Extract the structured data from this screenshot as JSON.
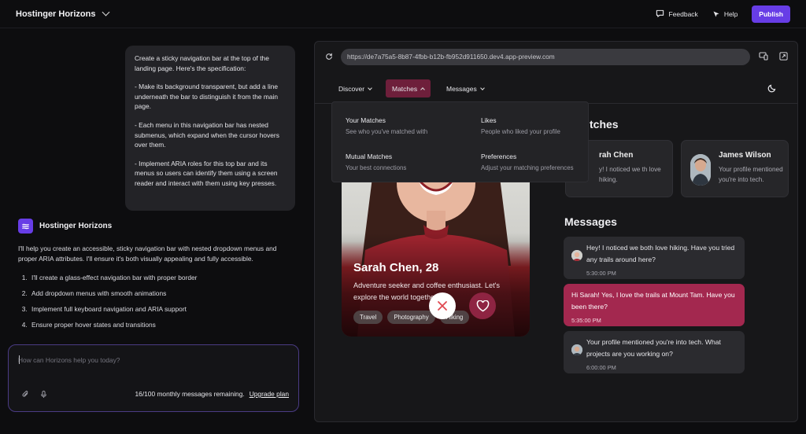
{
  "topbar": {
    "brand": "Hostinger Horizons",
    "feedback": "Feedback",
    "help": "Help",
    "publish": "Publish"
  },
  "chat": {
    "user_message": [
      "Create a sticky navigation bar at the top of the landing page. Here's the specification:",
      "- Make its background transparent, but add a line underneath the bar to distinguish it from the main page.",
      "- Each menu in this navigation bar has nested submenus, which expand when the cursor hovers over them.",
      "- Implement ARIA roles for this top bar and its menus so users can identify them using a screen reader and interact with them using key presses."
    ],
    "assistant_name": "Hostinger Horizons",
    "assistant_intro": "I'll help you create an accessible, sticky navigation bar with nested dropdown menus and proper ARIA attributes. I'll ensure it's both visually appealing and fully accessible.",
    "assistant_steps": [
      "I'll create a glass-effect navigation bar with proper border",
      "Add dropdown menus with smooth animations",
      "Implement full keyboard navigation and ARIA support",
      "Ensure proper hover states and transitions"
    ],
    "composer_placeholder": "How can Horizons help you today?",
    "remaining": "16/100 monthly messages remaining.",
    "upgrade": "Upgrade plan"
  },
  "preview": {
    "url": "https://de7a75a5-8b87-4fbb-b12b-fb952d911650.dev4.app-preview.com",
    "nav": [
      "Discover",
      "Matches",
      "Messages"
    ],
    "dropdown": [
      {
        "title": "Your Matches",
        "desc": "See who you've matched with"
      },
      {
        "title": "Likes",
        "desc": "People who liked your profile"
      },
      {
        "title": "Mutual Matches",
        "desc": "Your best connections"
      },
      {
        "title": "Preferences",
        "desc": "Adjust your matching preferences"
      }
    ],
    "profile": {
      "name": "Sarah Chen, 28",
      "bio": "Adventure seeker and coffee enthusiast. Let's explore the world together!",
      "tags": [
        "Travel",
        "Photography",
        "Hiking"
      ]
    },
    "matches_title": "tches",
    "match_cards": [
      {
        "name": "rah Chen",
        "text": "y! I noticed we th love hiking."
      },
      {
        "name": "James Wilson",
        "text": "Your profile mentioned you're into tech."
      }
    ],
    "messages_title": "Messages",
    "messages": [
      {
        "text": "Hey! I noticed we both love hiking. Have you tried any trails around here?",
        "time": "5:30:00 PM"
      },
      {
        "text": "Hi Sarah! Yes, I love the trails at Mount Tam. Have you been there?",
        "time": "5:35:00 PM"
      },
      {
        "text": "Your profile mentioned you're into tech. What projects are you working on?",
        "time": "6:00:00 PM"
      }
    ]
  },
  "colors": {
    "accent": "#673de6",
    "active_nav": "#6e1f3b",
    "highlight_message": "#a3284f"
  }
}
